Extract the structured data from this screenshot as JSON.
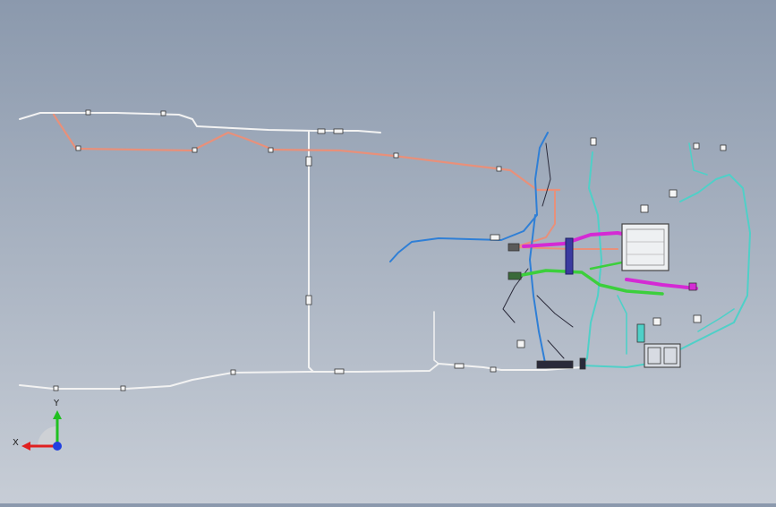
{
  "viewport": {
    "background_top": "#8b99ad",
    "background_bottom": "#c7cdd6"
  },
  "harness_colors": {
    "main_trunk": "#f2f2f2",
    "salmon_branch": "#e8907a",
    "blue_branch": "#2f7fd6",
    "teal_branch": "#4fd0c8",
    "magenta_branch": "#d42ad4",
    "green_branch": "#3ccf3c",
    "navy_clip": "#3a3aa0"
  },
  "axis_triad": {
    "x_label": "X",
    "y_label": "Y",
    "x_color": "#e02020",
    "y_color": "#20c020",
    "z_color": "#2040e0"
  }
}
